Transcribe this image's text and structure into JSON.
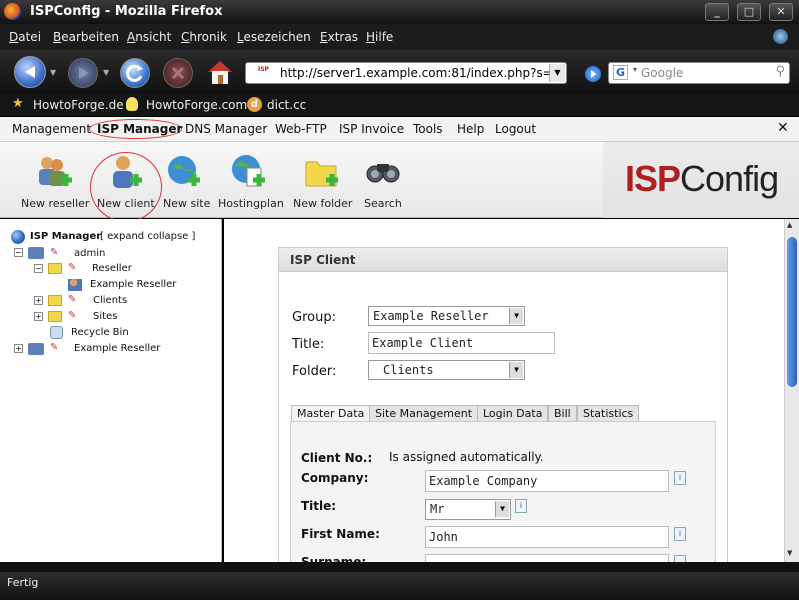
{
  "window": {
    "title": "ISPConfig - Mozilla Firefox",
    "minimize": "_",
    "maximize": "□",
    "close": "✕"
  },
  "menubar": [
    "Datei",
    "Bearbeiten",
    "Ansicht",
    "Chronik",
    "Lesezeichen",
    "Extras",
    "Hilfe"
  ],
  "nav": {
    "url": "http://server1.example.com:81/index.php?s=",
    "search_placeholder": "Google",
    "url_favicon": "ISP"
  },
  "bookmarks": [
    "HowtoForge.de",
    "HowtoForge.com",
    "dict.cc"
  ],
  "appmenu": {
    "items": [
      "Management",
      "ISP Manager",
      "DNS Manager",
      "Web-FTP",
      "ISP Invoice",
      "Tools",
      "Help",
      "Logout"
    ],
    "active": "ISP Manager",
    "close": "✕"
  },
  "toolbar": {
    "items": [
      "New reseller",
      "New client",
      "New site",
      "Hostingplan",
      "New folder",
      "Search"
    ],
    "highlighted": "New client"
  },
  "logo": {
    "isp": "ISP",
    "config": "Config",
    "isp_color": "#b01e1e",
    "config_color": "#222222"
  },
  "tree": {
    "root": "ISP Manager",
    "root_links": "[ expand  collapse ]",
    "nodes": [
      "admin",
      "Reseller",
      "Example Reseller",
      "Clients",
      "Sites",
      "Recycle Bin",
      "Example Reseller"
    ]
  },
  "form": {
    "heading": "ISP Client",
    "group_label": "Group:",
    "group_value": "Example Reseller",
    "title_label": "Title:",
    "title_value": "Example Client",
    "folder_label": "Folder:",
    "folder_value": "Clients",
    "tabs": [
      "Master Data",
      "Site Management",
      "Login Data",
      "Bill",
      "Statistics"
    ],
    "active_tab": "Master Data",
    "client_no_label": "Client No.:",
    "client_no_value": "Is assigned automatically.",
    "company_label": "Company:",
    "company_value": "Example Company",
    "ptitle_label": "Title:",
    "ptitle_value": "Mr",
    "first_name_label": "First Name:",
    "first_name_value": "John",
    "surname_label": "Surname:"
  },
  "status": {
    "text": "Fertig"
  }
}
